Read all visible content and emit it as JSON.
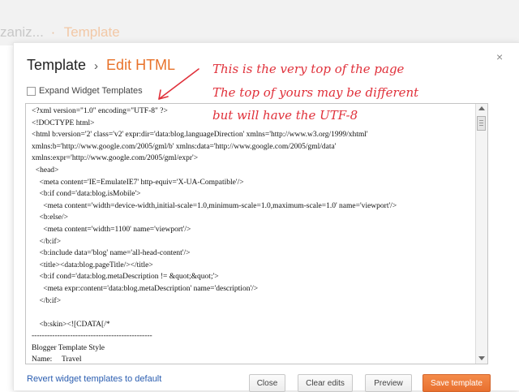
{
  "background": {
    "breadcrumb_partial": "zaniz...",
    "separator": "·",
    "current": "Template"
  },
  "dialog": {
    "breadcrumb": {
      "parent": "Template",
      "arrow": "›",
      "current": "Edit HTML"
    },
    "close_glyph": "×",
    "expand_checkbox": {
      "label": "Expand Widget Templates",
      "checked": false
    },
    "editor": {
      "code": "<?xml version=\"1.0\" encoding=\"UTF-8\" ?>\n<!DOCTYPE html>\n<html b:version='2' class='v2' expr:dir='data:blog.languageDirection' xmlns='http://www.w3.org/1999/xhtml'\nxmlns:b='http://www.google.com/2005/gml/b' xmlns:data='http://www.google.com/2005/gml/data'\nxmlns:expr='http://www.google.com/2005/gml/expr'>\n  <head>\n    <meta content='IE=EmulateIE7' http-equiv='X-UA-Compatible'/>\n    <b:if cond='data:blog.isMobile'>\n      <meta content='width=device-width,initial-scale=1.0,minimum-scale=1.0,maximum-scale=1.0' name='viewport'/>\n    <b:else/>\n      <meta content='width=1100' name='viewport'/>\n    </b:if>\n    <b:include data='blog' name='all-head-content'/>\n    <title><data:blog.pageTitle/></title>\n    <b:if cond='data:blog.metaDescription != &quot;&quot;'>\n      <meta expr:content='data:blog.metaDescription' name='description'/>\n    </b:if>\n\n    <b:skin><![CDATA[/*\n-----------------------------------------------\nBlogger Template Style\nName:     Travel\nDesigner: Sookhee Lee\nURL:      www.plyfly.net\n----------------------------------------------- */"
    },
    "revert_link": "Revert widget templates to default",
    "buttons": {
      "close": "Close",
      "clear_edits": "Clear edits",
      "preview": "Preview",
      "save": "Save template"
    }
  },
  "annotation": {
    "lines": [
      "This is the very top of the page",
      "The top of yours may be different",
      "but will have the UTF-8"
    ],
    "color": "#e0303a"
  },
  "colors": {
    "accent": "#e8722a",
    "link": "#2a5db0",
    "primary_button": "#ec7a38"
  }
}
